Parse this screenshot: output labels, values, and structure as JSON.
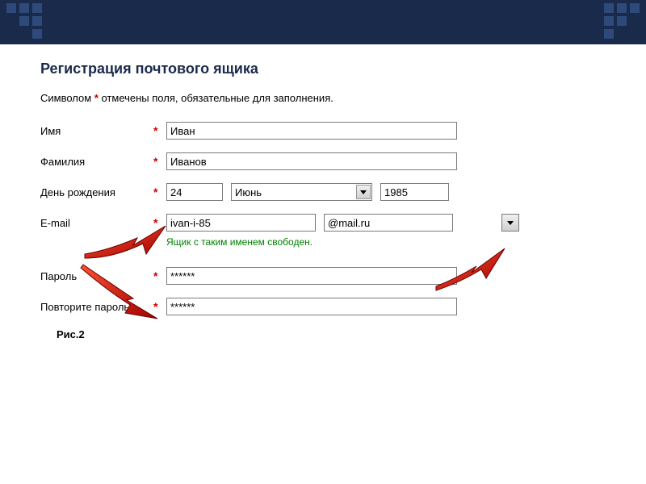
{
  "header": {
    "title": "Регистрация почтового ящика"
  },
  "hint": {
    "prefix": "Символом ",
    "asterisk": "*",
    "suffix": " отмечены поля, обязательные для заполнения."
  },
  "form": {
    "name": {
      "label": "Имя",
      "value": "Иван"
    },
    "surname": {
      "label": "Фамилия",
      "value": "Иванов"
    },
    "birthday": {
      "label": "День рождения",
      "day": "24",
      "month": "Июнь",
      "year": "1985"
    },
    "email": {
      "label": "E-mail",
      "value": "ivan-i-85",
      "domain": "@mail.ru",
      "status": "Ящик с таким именем свободен."
    },
    "password": {
      "label": "Пароль",
      "value": "******"
    },
    "password_confirm": {
      "label": "Повторите пароль",
      "value": "******"
    }
  },
  "caption": "Рис.2"
}
